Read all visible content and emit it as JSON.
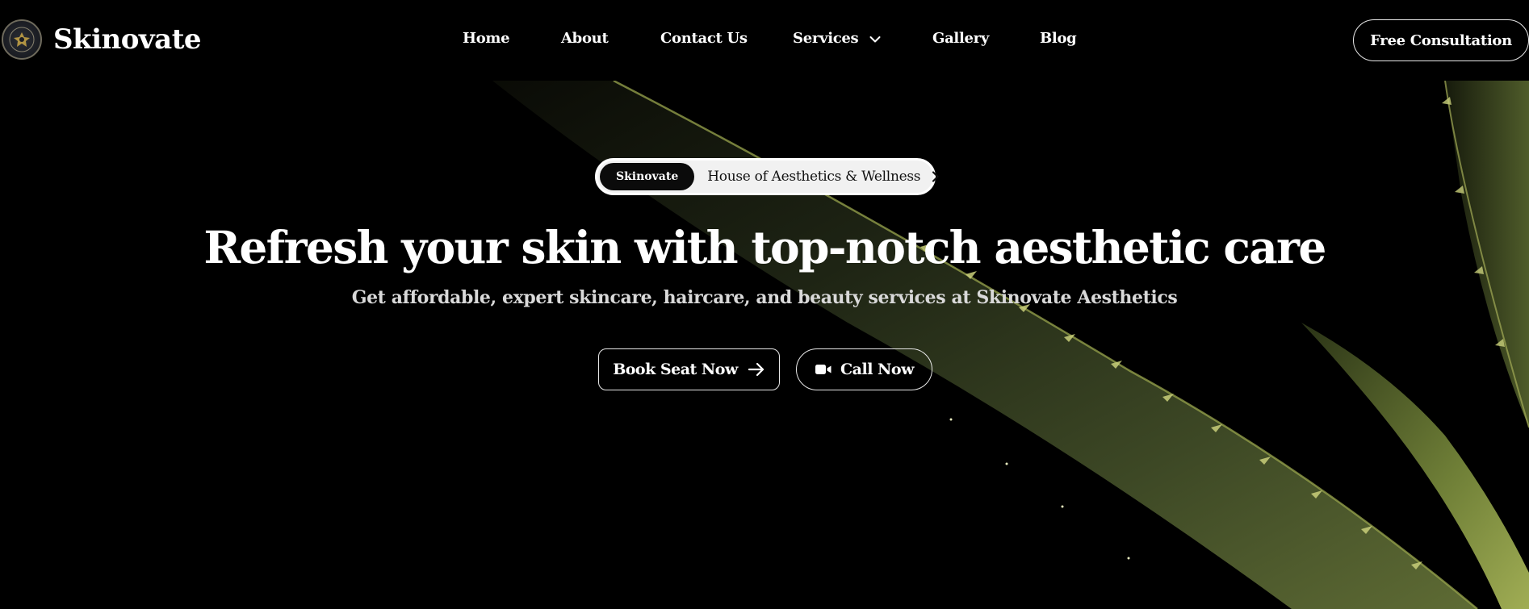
{
  "brand": {
    "name": "Skinovate",
    "logo_icon": "emblem-icon"
  },
  "nav": {
    "items": [
      {
        "label": "Home"
      },
      {
        "label": "About"
      },
      {
        "label": "Contact Us"
      },
      {
        "label": "Services",
        "icon": "chevron-down-icon"
      },
      {
        "label": "Gallery"
      },
      {
        "label": "Blog"
      }
    ],
    "cta_label": "Free Consultation"
  },
  "hero": {
    "badge": {
      "tag": "Skinovate",
      "text": "House of Aesthetics & Wellness",
      "icon": "chevron-right-icon"
    },
    "headline": "Refresh your skin with top-notch aesthetic care",
    "subheadline": "Get affordable, expert skincare, haircare, and beauty services at Skinovate Aesthetics",
    "buttons": {
      "book_label": "Book Seat Now",
      "book_icon": "arrow-right-icon",
      "call_label": "Call Now",
      "call_icon": "video-camera-icon"
    }
  },
  "colors": {
    "background": "#000000",
    "text": "#ffffff",
    "pill_background": "#f1f1f1",
    "leaf_green": "#8a9a3a"
  }
}
